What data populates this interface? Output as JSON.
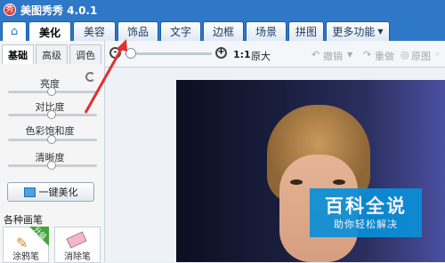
{
  "app": {
    "title": "美图秀秀 4.0.1",
    "logo_text": "秀"
  },
  "tabs": [
    {
      "label": "美化",
      "active": true
    },
    {
      "label": "美容"
    },
    {
      "label": "饰品"
    },
    {
      "label": "文字"
    },
    {
      "label": "边框"
    },
    {
      "label": "场景"
    },
    {
      "label": "拼图"
    },
    {
      "label": "更多功能"
    }
  ],
  "toolbar": {
    "ratio": "1:1",
    "original_size": "原大",
    "undo": "撤销",
    "redo": "重做",
    "original_image": "原图"
  },
  "left_panel": {
    "subtabs": [
      "基础",
      "高级",
      "调色"
    ],
    "adjustments": [
      {
        "label": "亮度",
        "value": 0.5
      },
      {
        "label": "对比度",
        "value": 0.5
      },
      {
        "label": "色彩饱和度",
        "value": 0.5
      },
      {
        "label": "清晰度",
        "value": 0.5
      }
    ],
    "beautify_button": "一键美化",
    "brush_title": "各种画笔",
    "brushes": [
      {
        "label": "涂鸦笔",
        "badge": "升级"
      },
      {
        "label": "消除笔"
      }
    ]
  },
  "watermark": {
    "title": "百科全说",
    "subtitle": "助你轻松解决"
  },
  "colors": {
    "accent": "#2f77c7",
    "watermark": "#0a8fd8",
    "arrow": "#e03030"
  }
}
